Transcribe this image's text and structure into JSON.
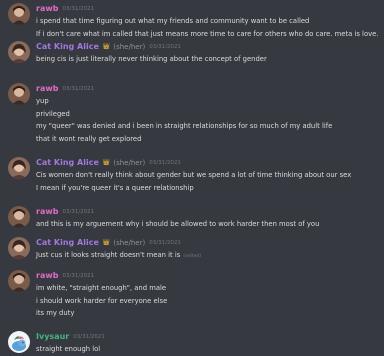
{
  "colors": {
    "background": "#36393f",
    "text": "#dcddde",
    "rawb": "#e06cc8",
    "alice": "#a178df",
    "ivysaur": "#43b581",
    "muted": "#72767d"
  },
  "messages": [
    {
      "author": "rawb",
      "author_key": "rawb",
      "timestamp": "03/31/2021",
      "pronouns": "",
      "lines": [
        "i spend that time figuring out what my friends and community want to be called",
        "If i don't care what im called that just means more time to care for others who do care. meta is love."
      ],
      "edited": ""
    },
    {
      "author": "Cat King Alice",
      "author_key": "alice",
      "timestamp": "03/31/2021",
      "pronouns": "(she/her)",
      "lines": [
        "being cis is just literally never thinking about the concept of gender"
      ],
      "edited": ""
    },
    {
      "author": "rawb",
      "author_key": "rawb",
      "timestamp": "03/31/2021",
      "pronouns": "",
      "lines": [
        "yup",
        "privileged",
        "my \"queer\" was denied and i been in straight relationships for so much of my adult life",
        "that it wont really get explored"
      ],
      "edited": ""
    },
    {
      "author": "Cat King Alice",
      "author_key": "alice",
      "timestamp": "03/31/2021",
      "pronouns": "(she/her)",
      "lines": [
        "Cis women don't really think about gender but we spend a lot of time thinking about our sex",
        "I mean if you're queer it's a queer relationship"
      ],
      "edited": ""
    },
    {
      "author": "rawb",
      "author_key": "rawb",
      "timestamp": "03/31/2021",
      "pronouns": "",
      "lines": [
        "and this is my arguement why i should be allowed to work harder then most of you"
      ],
      "edited": ""
    },
    {
      "author": "Cat King Alice",
      "author_key": "alice",
      "timestamp": "03/31/2021",
      "pronouns": "(she/her)",
      "lines": [
        "Just cus it looks straight doesn't mean it is"
      ],
      "edited": "(edited)"
    },
    {
      "author": "rawb",
      "author_key": "rawb",
      "timestamp": "03/31/2021",
      "pronouns": "",
      "lines": [
        "im white, \"straight enough\", and male",
        "i should work harder for everyone else",
        "its my duty"
      ],
      "edited": ""
    },
    {
      "author": "Ivysaur",
      "author_key": "ivysaur",
      "timestamp": "03/31/2021",
      "pronouns": "",
      "lines": [
        "straight enough lol"
      ],
      "edited": ""
    }
  ]
}
